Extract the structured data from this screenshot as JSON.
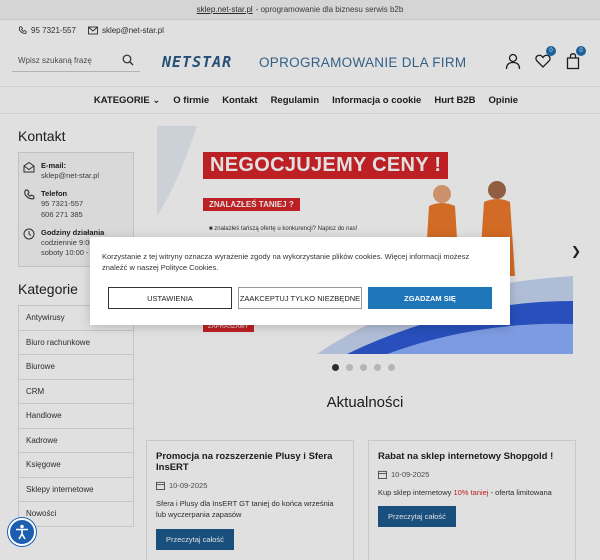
{
  "topbar": {
    "link": "sklep.net-star.pl",
    "text": "- oprogramowanie dla biznesu serwis b2b"
  },
  "contact_top": {
    "phone": "95 7321-557",
    "email": "sklep@net-star.pl"
  },
  "header": {
    "search_placeholder": "Wpisz szukaną frazę",
    "logo_text": "NETSTAR",
    "slogan": "OPROGRAMOWANIE DLA FIRM",
    "wishlist_count": "0",
    "cart_count": "0"
  },
  "nav": {
    "items": [
      "KATEGORIE",
      "O firmie",
      "Kontakt",
      "Regulamin",
      "Informacja o cookie",
      "Hurt B2B",
      "Opinie"
    ]
  },
  "sidebar": {
    "contact_title": "Kontakt",
    "email_label": "E-mail:",
    "email_value": "sklep@net-star.pl",
    "phone_label": "Telefon",
    "phone_1": "95 7321-557",
    "phone_2": "606 271 385",
    "hours_label": "Godziny działania",
    "hours_1": "codziennie 9:00",
    "hours_2": "soboty 10:00 -",
    "categories_title": "Kategorie",
    "categories": [
      "Antywirusy",
      "Biuro rachunkowe",
      "Biurowe",
      "CRM",
      "Handlowe",
      "Kadrowe",
      "Księgowe",
      "Sklepy internetowe",
      "Nowości"
    ]
  },
  "banner": {
    "headline": "NEGOCJUJEMY CENY !",
    "sub": "ZNALAZŁEŚ TANIEJ ?",
    "small": "■ znalazłeś tańszą ofertę u konkurencji? Napisz do nas!",
    "button": "ZAPRASZAMY",
    "active_slide": 1,
    "slide_count": 5
  },
  "news": {
    "title": "Aktualności",
    "cards": [
      {
        "title": "Promocja na rozszerzenie Plusy i Sfera InsERT",
        "date": "10-09-2025",
        "text": "Sfera i Plusy dla InsERT GT taniej do końca września lub wyczerpania zapasów",
        "highlight": "",
        "text_after": "",
        "button": "Przeczytaj całość"
      },
      {
        "title": "Rabat na sklep internetowy Shopgold !",
        "date": "10-09-2025",
        "text": "Kup sklep internetowy",
        "highlight": "10% taniej",
        "text_after": " - oferta limitowana",
        "button": "Przeczytaj całość"
      }
    ]
  },
  "cookie": {
    "text": "Korzystanie z tej witryny oznacza wyrażenie zgody na wykorzystanie plików cookies. Więcej informacji możesz znaleźć w naszej Polityce Cookies.",
    "btn_settings": "USTAWIENIA",
    "btn_necessary": "ZAAKCEPTUJ TYLKO NIEZBĘDNE",
    "btn_agree": "ZGADZAM SIĘ"
  },
  "colors": {
    "accent_red": "#d7252a",
    "brand_blue": "#1e76b9",
    "button_blue": "#1d5a8f"
  }
}
